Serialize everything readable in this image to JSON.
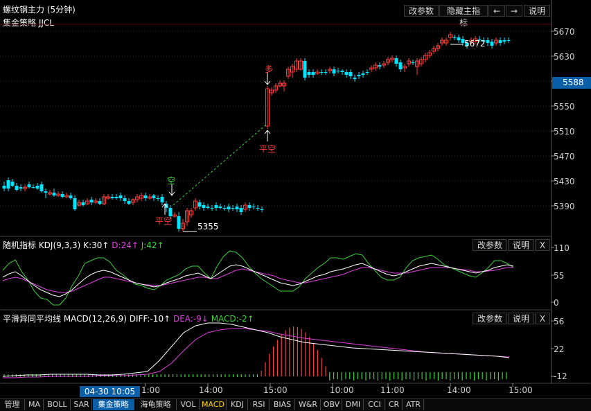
{
  "header": {
    "title": "螺纹钢主力 (5分钟)",
    "subtitle": "集金策略 JJCL",
    "buttons": [
      "改参数",
      "隐藏主指标",
      "←",
      "→",
      "说明"
    ]
  },
  "price_axis": {
    "labels": [
      "5670",
      "5630",
      "5590",
      "5550",
      "5510",
      "5470",
      "5430",
      "5390"
    ],
    "current": "5588"
  },
  "annotations": {
    "high": "5672",
    "low": "5355",
    "buy": "多",
    "short": "空",
    "close_short_1": "平空",
    "close_short_2": "平空"
  },
  "kdj": {
    "title_prefix": "随机指标 KDJ(9,3,3)",
    "k": "K:30↑",
    "d": "D:24↑",
    "j": "J:42↑",
    "axis": [
      "110",
      "55",
      "0"
    ],
    "buttons": [
      "改参数",
      "说明",
      "X"
    ]
  },
  "macd": {
    "title_prefix": "平滑异同平均线 MACD(12,26,9)",
    "diff": "DIFF:-10↑",
    "dea": "DEA:-9↓",
    "macd": "MACD:-2↑",
    "axis": [
      "56",
      "22",
      "-12"
    ],
    "buttons": [
      "改参数",
      "说明",
      "X"
    ]
  },
  "time_axis": {
    "cursor": "04-30 10:05",
    "labels": [
      "1:00",
      "14:00",
      "15:00",
      "10:00",
      "11:00",
      "14:00",
      "15:00"
    ]
  },
  "tabs": [
    "管理",
    "MA",
    "BOLL",
    "SAR",
    "集金策略",
    "海龟策略",
    "VOL",
    "MACD",
    "KDJ",
    "RSI",
    "BIAS",
    "W&R",
    "OBV",
    "DMI",
    "CCI",
    "CR",
    "ATR"
  ],
  "colors": {
    "up": "#ff3b3b",
    "down": "#00e5ff",
    "k": "#ffffff",
    "d": "#e040e0",
    "j": "#3cd23c",
    "accent": "#0a5fa8"
  }
}
